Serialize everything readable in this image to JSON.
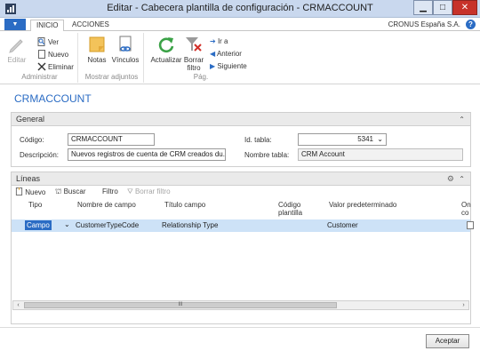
{
  "window": {
    "title": "Editar - Cabecera plantilla de configuración - CRMACCOUNT",
    "minimize": "▁",
    "maximize": "□",
    "close": "✕"
  },
  "tabs": {
    "file_menu": "▼",
    "items": [
      "INICIO",
      "ACCIONES"
    ],
    "company": "CRONUS España S.A.",
    "help": "?"
  },
  "ribbon": {
    "administrar": {
      "label": "Administrar",
      "editar": "Editar",
      "ver": "Ver",
      "nuevo": "Nuevo",
      "eliminar": "Eliminar"
    },
    "adjuntos": {
      "label": "Mostrar adjuntos",
      "notas": "Notas",
      "vinculos": "Vínculos"
    },
    "pag": {
      "label": "Pág.",
      "actualizar": "Actualizar",
      "borrar_filtro_1": "Borrar",
      "borrar_filtro_2": "filtro",
      "ir_a": "Ir a",
      "anterior": "Anterior",
      "siguiente": "Siguiente"
    }
  },
  "page_title": "CRMACCOUNT",
  "general": {
    "header": "General",
    "codigo_label": "Código:",
    "codigo_value": "CRMACCOUNT",
    "descripcion_label": "Descripción:",
    "descripcion_value": "Nuevos registros de cuenta de CRM creados du...",
    "id_tabla_label": "Id. tabla:",
    "id_tabla_value": "5341",
    "nombre_tabla_label": "Nombre tabla:",
    "nombre_tabla_value": "CRM Account"
  },
  "lineas": {
    "header": "Líneas",
    "toolbar": {
      "nuevo": "Nuevo",
      "buscar": "Buscar",
      "filtro": "Filtro",
      "borrar_filtro": "Borrar filtro"
    },
    "columns": {
      "tipo": "Tipo",
      "nombre_campo": "Nombre de campo",
      "titulo_campo": "Título campo",
      "codigo_plantilla_1": "Código",
      "codigo_plantilla_2": "plantilla",
      "valor_predeterminado": "Valor predeterminado",
      "on_1": "On",
      "on_2": "co"
    },
    "rows": [
      {
        "tipo": "Campo",
        "nombre_campo": "CustomerTypeCode",
        "titulo_campo": "Relationship Type",
        "codigo_plantilla": "",
        "valor_predeterminado": "Customer"
      }
    ],
    "scroll_thumb": "III"
  },
  "accept_button": "Aceptar",
  "colors": {
    "accent": "#2b6cc4",
    "selected_row": "#cde2f7",
    "titlebar": "#c9d8ee",
    "close": "#c7322a"
  }
}
